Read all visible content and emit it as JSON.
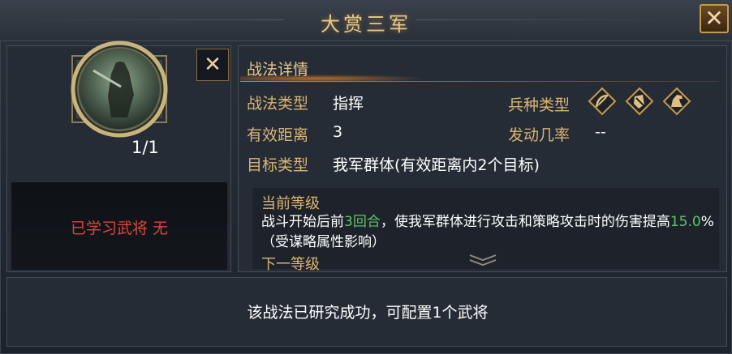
{
  "window": {
    "title": "大赏三军"
  },
  "skill": {
    "count": "1/1",
    "learned_text": "已学习武将 无"
  },
  "detail": {
    "title": "战法详情",
    "type_label": "战法类型",
    "type_value": "指挥",
    "troop_label": "兵种类型",
    "troop_icons": [
      "bow-icon",
      "shield-icon",
      "horse-icon"
    ],
    "range_label": "有效距离",
    "range_value": "3",
    "rate_label": "发动几率",
    "rate_value": "--",
    "target_label": "目标类型",
    "target_value": "我军群体(有效距离内2个目标)"
  },
  "level": {
    "current_title": "当前等级",
    "desc_1": "战斗开始后前",
    "desc_rounds": "3回合",
    "desc_2": "，使我军群体进行攻击和策略攻击时的伤害提高",
    "desc_percent": "15.0",
    "desc_3": "%（受谋略属性影响）",
    "next_title": "下一等级"
  },
  "footer": {
    "status": "该战法已研究成功，可配置1个武将"
  },
  "colors": {
    "gold": "#d9b574",
    "title_gold": "#e8c88a",
    "red": "#e0453a",
    "green": "#5fc26a",
    "panel_bg": "#262c35"
  }
}
